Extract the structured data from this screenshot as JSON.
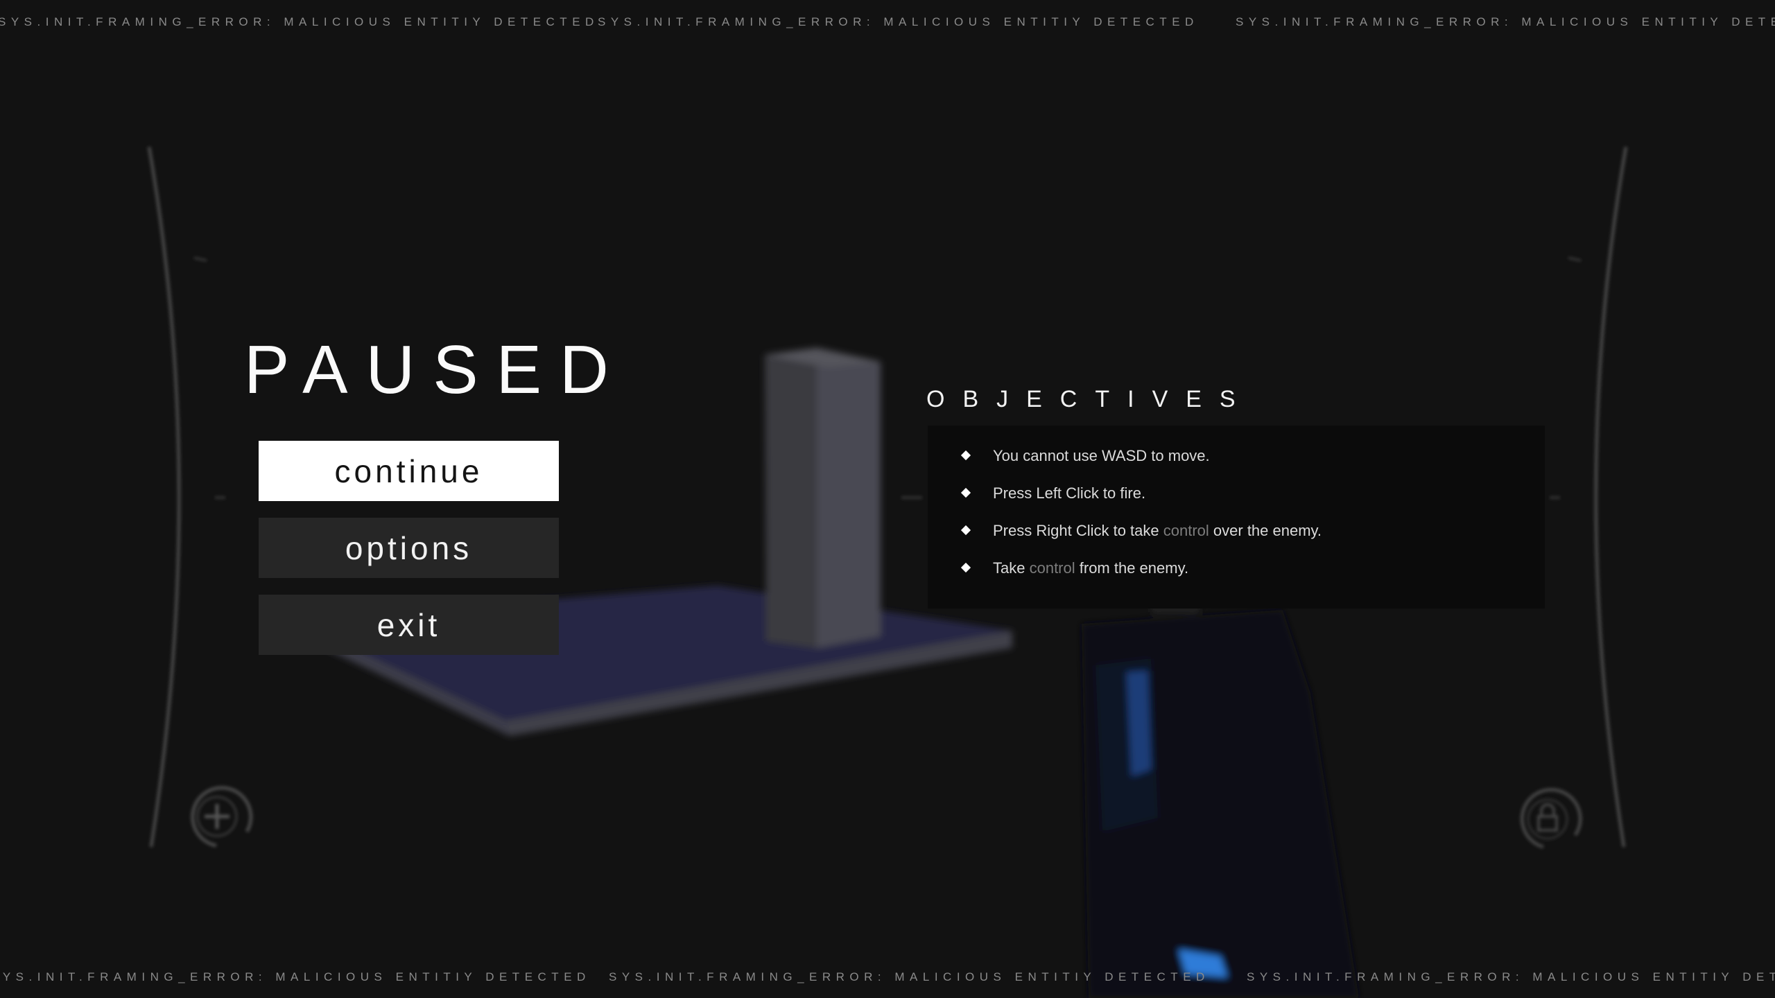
{
  "ticker": {
    "top": [
      "SYS.INIT.FRAMING_ERROR: MALICIOUS ENTITIY DETECTED",
      "SYS.INIT.FRAMING_ERROR: MALICIOUS ENTITIY DETECTED",
      "SYS.INIT.FRAMING_ERROR: MALICIOUS ENTITIY DETECTED"
    ],
    "bottom": [
      "SYS.INIT.FRAMING_ERROR: MALICIOUS ENTITIY DETECTED",
      "SYS.INIT.FRAMING_ERROR: MALICIOUS ENTITIY DETECTED",
      "SYS.INIT.FRAMING_ERROR: MALICIOUS ENTITIY DETECTED"
    ]
  },
  "pause_menu": {
    "title": "PAUSED",
    "buttons": {
      "continue": "continue",
      "options": "options",
      "exit": "exit"
    }
  },
  "objectives": {
    "title": "OBJECTIVES",
    "items": [
      {
        "before": "You cannot use WASD to move.",
        "highlight": "",
        "after": ""
      },
      {
        "before": "Press Left Click to fire.",
        "highlight": "",
        "after": ""
      },
      {
        "before": "Press Right Click to take ",
        "highlight": "control",
        "after": " over the enemy."
      },
      {
        "before": "Take ",
        "highlight": "control",
        "after": " from the enemy."
      }
    ]
  },
  "hud": {
    "left_icon": "plus-circle-icon",
    "right_icon": "lock-circle-icon"
  },
  "colors": {
    "background": "#121212",
    "active_button": "#ffffff",
    "inactive_button": "#262626",
    "highlight_text": "#7d7d7d",
    "player_accent": "#2f7bd8"
  }
}
